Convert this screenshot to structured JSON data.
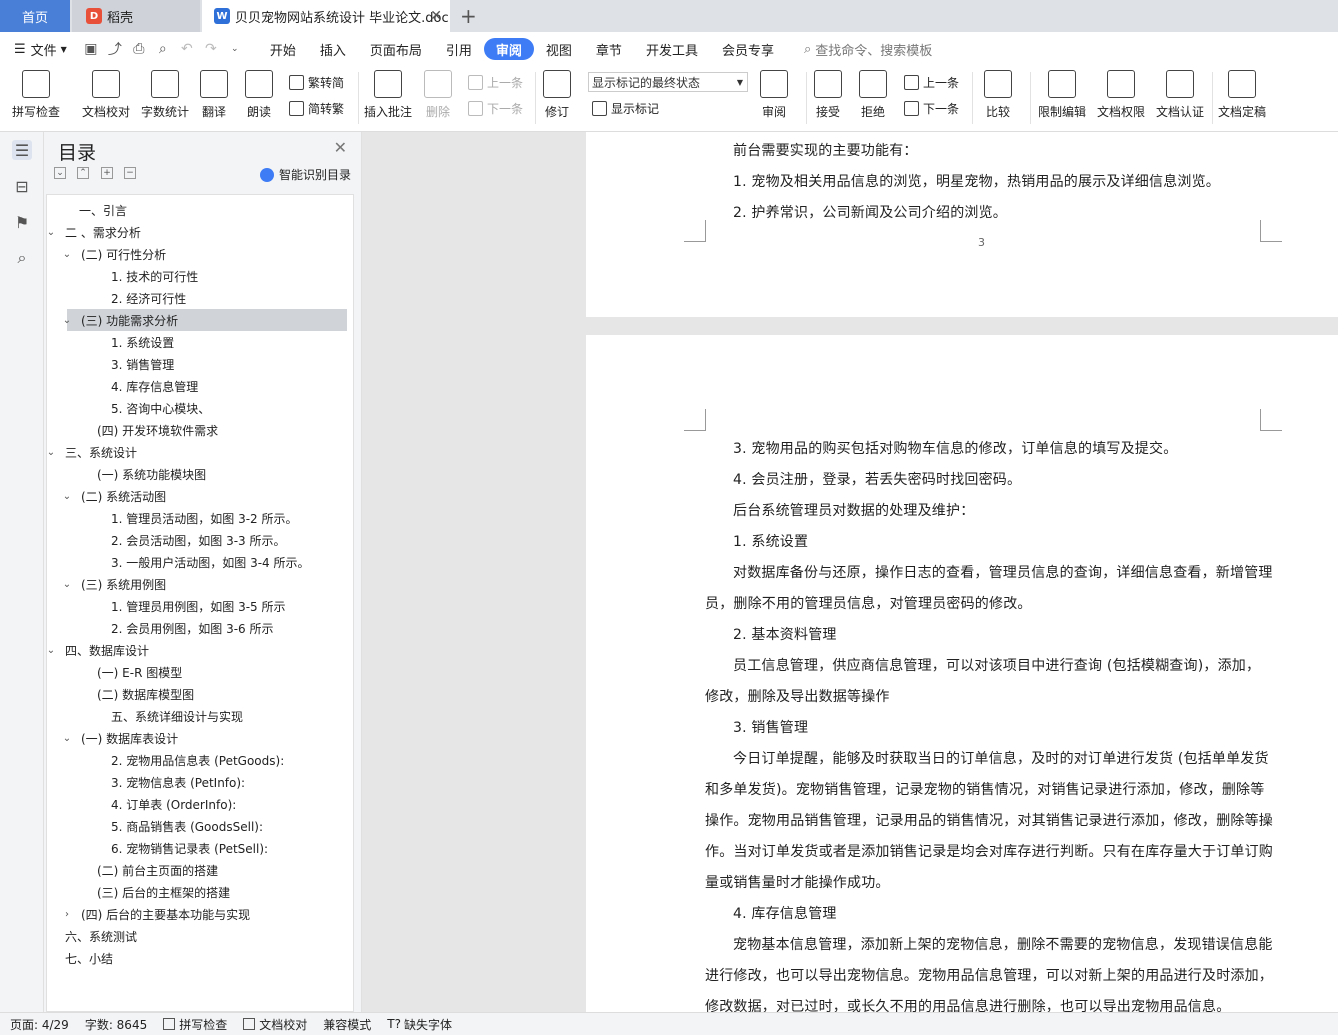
{
  "tabs": {
    "home": "首页",
    "daoke": "稻壳",
    "doc": "贝贝宠物网站系统设计 毕业论文.doc"
  },
  "menubar": {
    "file": "文件",
    "items": [
      "开始",
      "插入",
      "页面布局",
      "引用",
      "审阅",
      "视图",
      "章节",
      "开发工具",
      "会员专享"
    ],
    "active": "审阅",
    "search": "查找命令、搜索模板"
  },
  "ribbon": {
    "spell": "拼写检查",
    "proof": "文档校对",
    "wordcount": "字数统计",
    "translate": "翻译",
    "read": "朗读",
    "trad": "繁转简",
    "simp": "简转繁",
    "insert_comment": "插入批注",
    "delete": "删除",
    "prev": "上一条",
    "next": "下一条",
    "track": "修订",
    "markup_state": "显示标记的最终状态",
    "show_markup": "显示标记",
    "review": "审阅",
    "accept": "接受",
    "reject": "拒绝",
    "prev2": "上一条",
    "next2": "下一条",
    "compare": "比较",
    "restrict": "限制编辑",
    "permission": "文档权限",
    "certify": "文档认证",
    "finalize": "文档定稿"
  },
  "toc": {
    "title": "目录",
    "smart": "智能识别目录",
    "items": [
      {
        "text": "一、引言",
        "arrow": ""
      },
      {
        "text": "二 、需求分析",
        "arrow": "v"
      },
      {
        "text": "(二) 可行性分析",
        "arrow": "v"
      },
      {
        "text": "1. 技术的可行性",
        "arrow": ""
      },
      {
        "text": "2.  经济可行性",
        "arrow": ""
      },
      {
        "text": "(三) 功能需求分析",
        "arrow": "v"
      },
      {
        "text": "1. 系统设置",
        "arrow": ""
      },
      {
        "text": "3. 销售管理",
        "arrow": ""
      },
      {
        "text": "4. 库存信息管理",
        "arrow": ""
      },
      {
        "text": "5. 咨询中心模块、",
        "arrow": ""
      },
      {
        "text": "(四) 开发环境软件需求",
        "arrow": ""
      },
      {
        "text": "三、系统设计",
        "arrow": "v"
      },
      {
        "text": "(一) 系统功能模块图",
        "arrow": ""
      },
      {
        "text": "(二) 系统活动图",
        "arrow": "v"
      },
      {
        "text": "1. 管理员活动图，如图 3-2 所示。",
        "arrow": ""
      },
      {
        "text": "2. 会员活动图，如图 3-3 所示。",
        "arrow": ""
      },
      {
        "text": "3. 一般用户活动图，如图 3-4 所示。",
        "arrow": ""
      },
      {
        "text": "(三) 系统用例图",
        "arrow": "v"
      },
      {
        "text": "1. 管理员用例图，如图 3-5 所示",
        "arrow": ""
      },
      {
        "text": "2. 会员用例图，如图 3-6 所示",
        "arrow": ""
      },
      {
        "text": "四、数据库设计",
        "arrow": "v"
      },
      {
        "text": "(一) E-R 图模型",
        "arrow": ""
      },
      {
        "text": "(二) 数据库模型图",
        "arrow": ""
      },
      {
        "text": "五、系统详细设计与实现",
        "arrow": ""
      },
      {
        "text": "(一) 数据库表设计",
        "arrow": "v"
      },
      {
        "text": "2. 宠物用品信息表 (PetGoods):",
        "arrow": ""
      },
      {
        "text": "3. 宠物信息表 (PetInfo):",
        "arrow": ""
      },
      {
        "text": "4. 订单表 (OrderInfo):",
        "arrow": ""
      },
      {
        "text": "5. 商品销售表 (GoodsSell):",
        "arrow": ""
      },
      {
        "text": "6. 宠物销售记录表 (PetSell):",
        "arrow": ""
      },
      {
        "text": "(二) 前台主页面的搭建",
        "arrow": ""
      },
      {
        "text": "(三) 后台的主框架的搭建",
        "arrow": ""
      },
      {
        "text": "(四) 后台的主要基本功能与实现",
        "arrow": ">"
      },
      {
        "text": "六、系统测试",
        "arrow": ""
      },
      {
        "text": "七、小结",
        "arrow": ""
      }
    ]
  },
  "page1": {
    "lines": [
      "前台需要实现的主要功能有：",
      "1. 宠物及相关用品信息的浏览，明星宠物，热销用品的展示及详细信息浏览。",
      "2. 护养常识，公司新闻及公司介绍的浏览。"
    ],
    "page_number": "3"
  },
  "page2": {
    "lines": [
      "3. 宠物用品的购买包括对购物车信息的修改，订单信息的填写及提交。",
      "4. 会员注册，登录，若丢失密码时找回密码。",
      "后台系统管理员对数据的处理及维护：",
      "1. 系统设置",
      "对数据库备份与还原，操作日志的查看，管理员信息的查询，详细信息查看，新增管理",
      "员，删除不用的管理员信息，对管理员密码的修改。",
      "2. 基本资料管理",
      "员工信息管理，供应商信息管理，可以对该项目中进行查询 (包括模糊查询)，添加，",
      "修改，删除及导出数据等操作",
      "3. 销售管理",
      "今日订单提醒，能够及时获取当日的订单信息，及时的对订单进行发货 (包括单单发货",
      "和多单发货)。宠物销售管理，记录宠物的销售情况，对销售记录进行添加，修改，删除等",
      "操作。宠物用品销售管理，记录用品的销售情况，对其销售记录进行添加，修改，删除等操",
      "作。当对订单发货或者是添加销售记录是均会对库存进行判断。只有在库存量大于订单订购",
      "量或销售量时才能操作成功。",
      "4. 库存信息管理",
      "宠物基本信息管理，添加新上架的宠物信息，删除不需要的宠物信息，发现错误信息能",
      "进行修改，也可以导出宠物信息。宠物用品信息管理，可以对新上架的用品进行及时添加，",
      "修改数据，对已过时，或长久不用的用品信息进行删除，也可以导出宠物用品信息。"
    ]
  },
  "status": {
    "page": "页面: 4/29",
    "words": "字数: 8645",
    "spell": "拼写检查",
    "proof": "文档校对",
    "compat": "兼容模式",
    "font": "缺失字体"
  }
}
